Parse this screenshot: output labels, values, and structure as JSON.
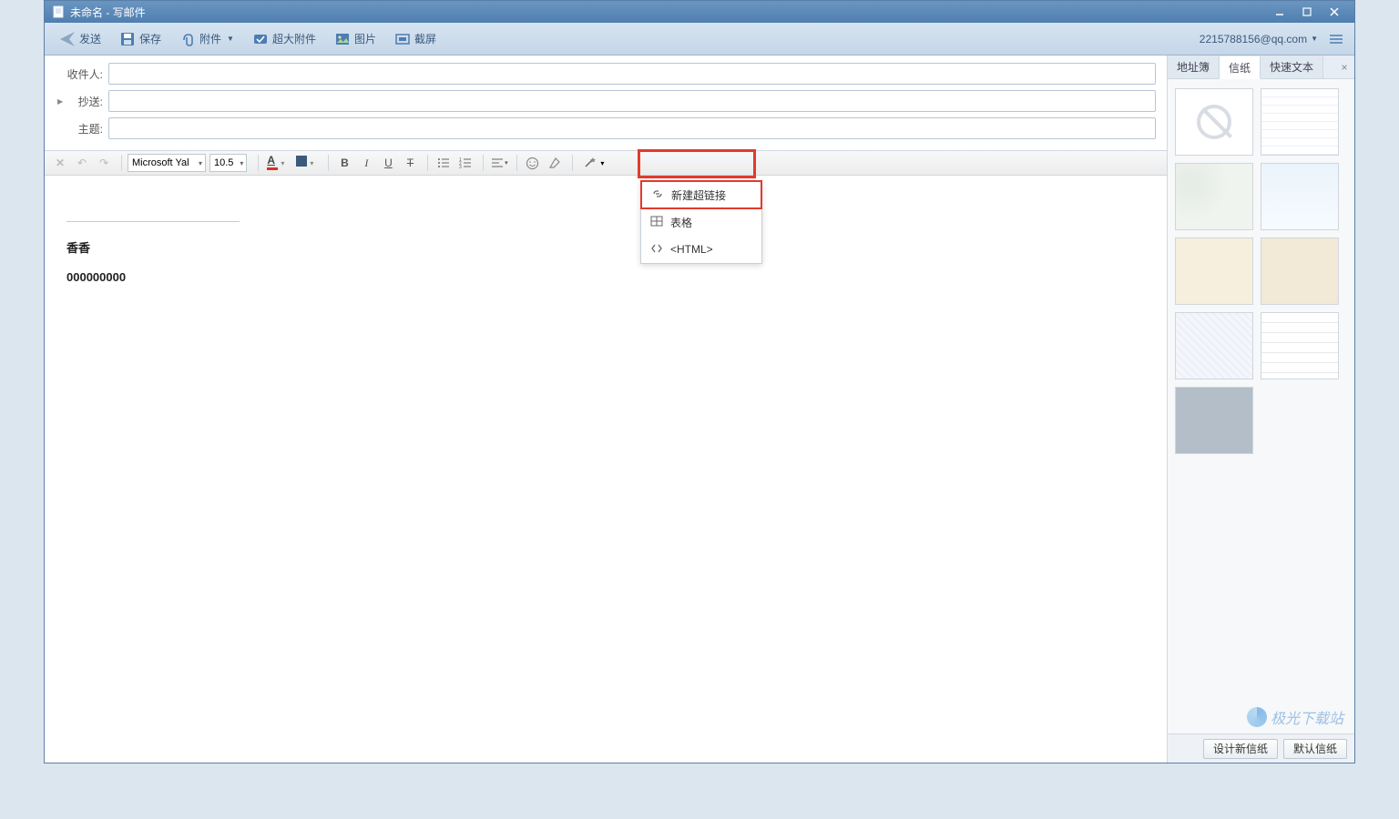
{
  "title": "未命名 - 写邮件",
  "account_email": "2215788156@qq.com",
  "toolbar": {
    "send": "发送",
    "save": "保存",
    "attach": "附件",
    "bigattach": "超大附件",
    "image": "图片",
    "screenshot": "截屏"
  },
  "fields": {
    "to_label": "收件人:",
    "cc_label": "抄送:",
    "subject_label": "主题:",
    "to_value": "",
    "cc_value": "",
    "subject_value": ""
  },
  "editor": {
    "font_family": "Microsoft Yal",
    "font_size": "10.5",
    "signature_name": "香香",
    "signature_number": "000000000"
  },
  "insert_menu": {
    "hyperlink": "新建超链接",
    "table": "表格",
    "html": "<HTML>"
  },
  "sidebar": {
    "tabs": {
      "addressbook": "地址簿",
      "stationery": "信纸",
      "quicktext": "快速文本"
    },
    "foot": {
      "design": "设计新信纸",
      "default": "默认信纸"
    }
  },
  "watermark": "极光下载站"
}
